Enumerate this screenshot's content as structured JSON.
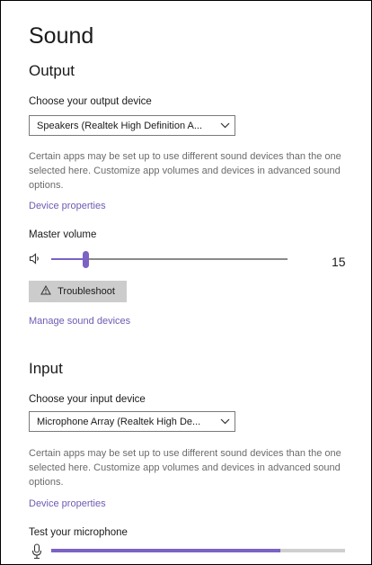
{
  "page": {
    "title": "Sound",
    "accent_color": "#7b62c4",
    "link_color": "#6f5bb3"
  },
  "output": {
    "heading": "Output",
    "device_label": "Choose your output device",
    "device_value": "Speakers (Realtek High Definition A...",
    "help_text": "Certain apps may be set up to use different sound devices than the one selected here. Customize app volumes and devices in advanced sound options.",
    "device_properties_link": "Device properties",
    "master_volume_label": "Master volume",
    "master_volume_value": "15",
    "master_volume_level": 0.15,
    "speaker_icon": "speaker-icon",
    "troubleshoot_icon": "warning-icon",
    "troubleshoot_label": "Troubleshoot",
    "manage_devices_link": "Manage sound devices"
  },
  "input": {
    "heading": "Input",
    "device_label": "Choose your input device",
    "device_value": "Microphone Array (Realtek High De...",
    "help_text": "Certain apps may be set up to use different sound devices than the one selected here. Customize app volumes and devices in advanced sound options.",
    "device_properties_link": "Device properties",
    "test_label": "Test your microphone",
    "mic_icon": "microphone-icon",
    "mic_level": 0.78
  }
}
